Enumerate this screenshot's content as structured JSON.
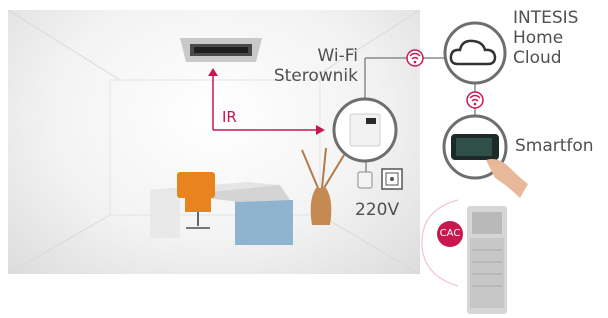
{
  "labels": {
    "ir": "IR",
    "wifi_controller": "Wi-Fi\nSterownik",
    "cloud": "INTESIS\nHome\nCloud",
    "smartphone": "Smartfon",
    "voltage": "220V",
    "cac_badge": "CAC"
  },
  "icons": [
    "ceiling-ac-cassette-icon",
    "wifi-controller-icon",
    "power-socket-icon",
    "cloud-icon",
    "smartphone-icon",
    "wifi-signal-icon",
    "outdoor-unit-icon"
  ],
  "colors": {
    "accent": "#c8174f",
    "text": "#505050",
    "connector": "#8a8a8a"
  }
}
